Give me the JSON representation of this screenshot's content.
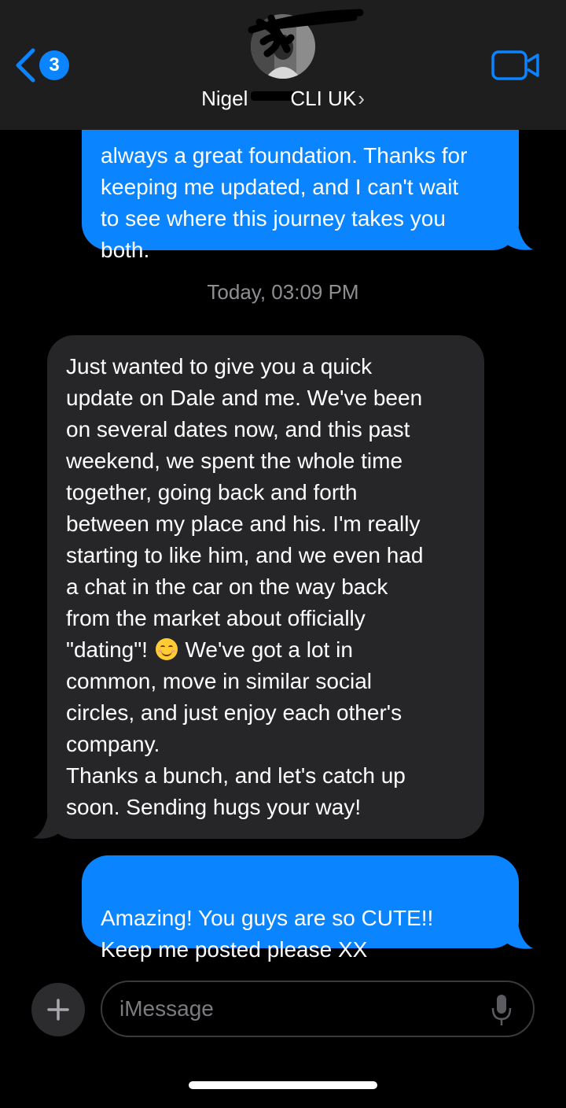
{
  "header": {
    "back_count": "3",
    "contact_name_start": "Nigel",
    "contact_name_end": "CLI UK",
    "chevron": "›",
    "back_icon": "chevron-left-icon",
    "video_icon": "video-camera-icon"
  },
  "messages": [
    {
      "direction": "outgoing",
      "text": "always a great foundation. Thanks for\nkeeping me updated, and I can't wait\nto see where this journey takes you\nboth."
    },
    {
      "direction": "timestamp",
      "text": "Today, 03:09 PM"
    },
    {
      "direction": "incoming",
      "text_part1": "Just wanted to give you a quick\nupdate on Dale and me. We've been\non several dates now, and this past\nweekend, we spent the whole time\ntogether, going back and forth\nbetween my place and his. I'm really\nstarting to like him, and we even had\na chat in the car on the way back\nfrom the market about officially\n\"dating\"! ",
      "emoji": "smiling-face-emoji",
      "text_part2": " We've got a lot in\ncommon, move in similar social\ncircles, and just enjoy each other's\ncompany.\nThanks a bunch, and let's catch up\nsoon. Sending hugs your way!"
    },
    {
      "direction": "outgoing",
      "text": "Amazing! You guys are so CUTE!!\nKeep me posted please XX"
    }
  ],
  "compose": {
    "placeholder": "iMessage",
    "plus_icon": "plus-icon",
    "mic_icon": "microphone-icon"
  },
  "colors": {
    "outgoing_bubble": "#0a84ff",
    "incoming_bubble": "#262628",
    "header_bg": "#1e1e1e",
    "background": "#000000",
    "timestamp": "#8e8e93"
  }
}
